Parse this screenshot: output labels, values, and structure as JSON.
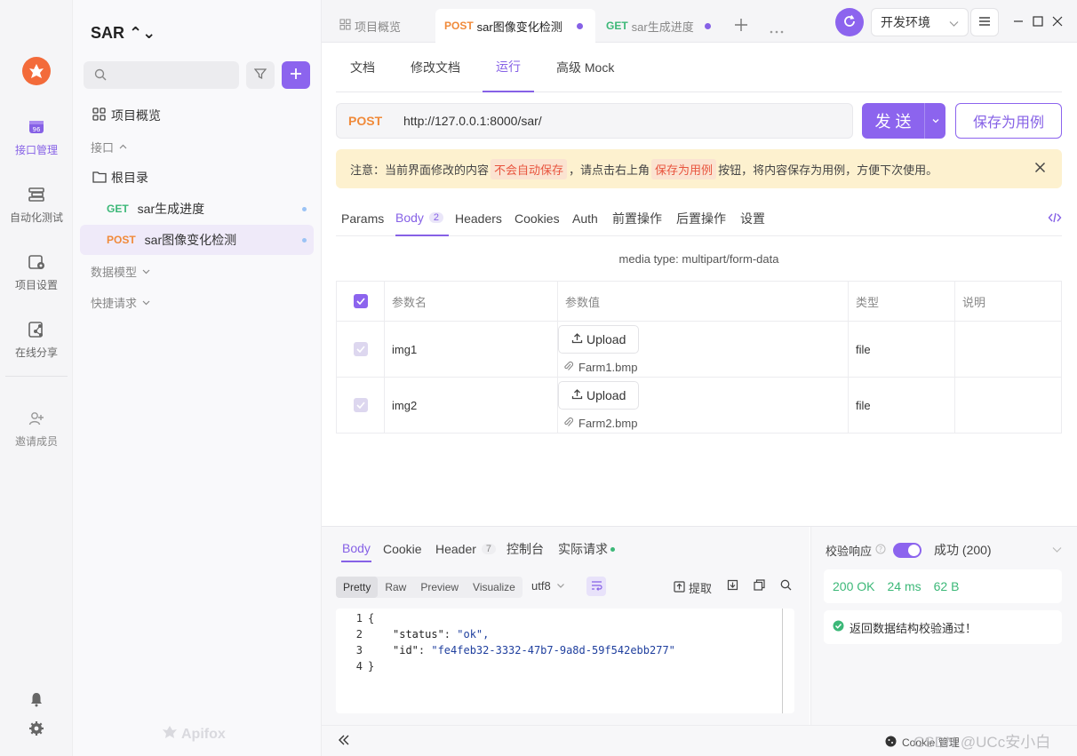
{
  "rail": {
    "items": [
      {
        "label": "接口管理",
        "icon": "api-icon"
      },
      {
        "label": "自动化测试",
        "icon": "automation-icon"
      },
      {
        "label": "项目设置",
        "icon": "project-settings-icon"
      },
      {
        "label": "在线分享",
        "icon": "share-icon"
      },
      {
        "label": "邀请成员",
        "icon": "invite-icon"
      }
    ]
  },
  "sidebar": {
    "project_title": "SAR ⌃⌄",
    "overview": "项目概览",
    "api_section": "接口",
    "root_folder": "根目录",
    "apis": [
      {
        "method": "GET",
        "name": "sar生成进度"
      },
      {
        "method": "POST",
        "name": "sar图像变化检测"
      }
    ],
    "data_models": "数据模型",
    "quick_requests": "快捷请求",
    "brand": "Apifox"
  },
  "tabs": [
    {
      "label": "项目概览"
    },
    {
      "method": "POST",
      "label": "sar图像变化检测"
    },
    {
      "method": "GET",
      "label": "sar生成进度"
    }
  ],
  "env": {
    "label": "开发环境"
  },
  "subtabs": [
    "文档",
    "修改文档",
    "运行",
    "高级 Mock"
  ],
  "request": {
    "method": "POST",
    "url": "http://127.0.0.1:8000/sar/",
    "send_label": "发 送",
    "save_label": "保存为用例"
  },
  "notice": {
    "part1": "注意：当前界面修改的内容",
    "hl1": "不会自动保存",
    "part2": "，请点击右上角",
    "hl2": "保存为用例",
    "part3": "按钮，将内容保存为用例，方便下次使用。"
  },
  "param_tabs": {
    "params": "Params",
    "body": "Body",
    "body_count": "2",
    "headers": "Headers",
    "cookies": "Cookies",
    "auth": "Auth",
    "pre": "前置操作",
    "post": "后置操作",
    "settings": "设置"
  },
  "media_type": "media type: multipart/form-data",
  "table": {
    "headers": [
      "参数名",
      "参数值",
      "类型",
      "说明"
    ],
    "upload_label": "Upload",
    "rows": [
      {
        "name": "img1",
        "file": "Farm1.bmp",
        "type": "file"
      },
      {
        "name": "img2",
        "file": "Farm2.bmp",
        "type": "file"
      }
    ]
  },
  "response": {
    "tabs": {
      "body": "Body",
      "cookie": "Cookie",
      "header": "Header",
      "header_count": "7",
      "console": "控制台",
      "actual": "实际请求"
    },
    "formats": [
      "Pretty",
      "Raw",
      "Preview",
      "Visualize"
    ],
    "encoding": "utf8",
    "extract": "提取",
    "code": [
      {
        "n": "1",
        "text": "{"
      },
      {
        "n": "2",
        "key": "\"status\"",
        "val": "\"ok\","
      },
      {
        "n": "3",
        "key": "\"id\"",
        "val": "\"fe4feb32-3332-47b7-9a8d-59f542ebb277\""
      },
      {
        "n": "4",
        "text": "}"
      }
    ],
    "validate_label": "校验响应",
    "validate_status": "成功 (200)",
    "status": "200 OK",
    "time": "24 ms",
    "size": "62 B",
    "validate_msg": "返回数据结构校验通过！"
  },
  "footer": {
    "cookie": "Cookie 管理",
    "watermark": "CSDN @UCc安小白"
  },
  "colors": {
    "accent": "#8c64ee",
    "get": "#3cb878",
    "post": "#f08a3a"
  }
}
